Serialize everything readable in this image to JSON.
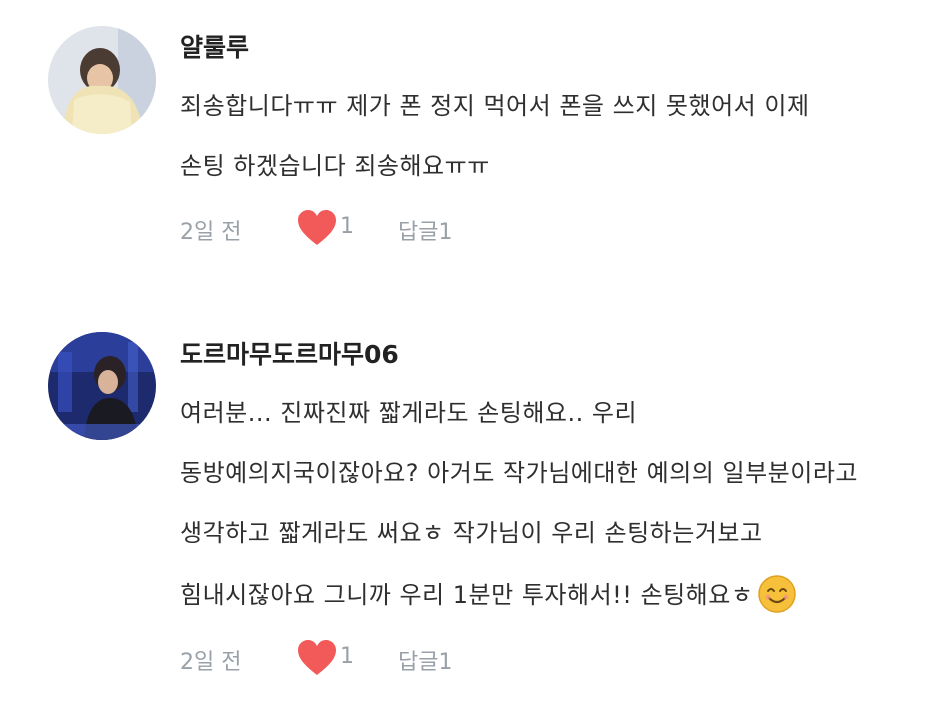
{
  "comments": [
    {
      "author": "얄룰루",
      "lines": [
        "죄송합니다ㅠㅠ 제가 폰 정지 먹어서 폰을 쓰지 못했어서 이제",
        "손팅 하겠습니다 죄송해요ㅠㅠ"
      ],
      "time": "2일 전",
      "likes": "1",
      "reply_label": "답글",
      "reply_count": "1",
      "avatar_icon": "person-wrapped-in-blanket-photo"
    },
    {
      "author": "도르마무도르마무06",
      "lines": [
        "여러분... 진짜진짜 짧게라도 손팅해요.. 우리",
        "동방예의지국이잖아요? 아거도 작가님에대한 예의의 일부분이라고",
        "생각하고 짧게라도 써요ㅎ 작가님이 우리 손팅하는거보고",
        "힘내시잖아요 그니까 우리 1분만 투자해서!! 손팅해요ㅎ"
      ],
      "time": "2일 전",
      "likes": "1",
      "reply_label": "답글",
      "reply_count": "1",
      "avatar_icon": "person-on-stage-photo",
      "trailing_emoji": "smiling-face-emoji"
    }
  ],
  "colors": {
    "heart": "#f25a5a",
    "meta_text": "#9aa0a8",
    "emoji_face": "#f7c03a"
  }
}
